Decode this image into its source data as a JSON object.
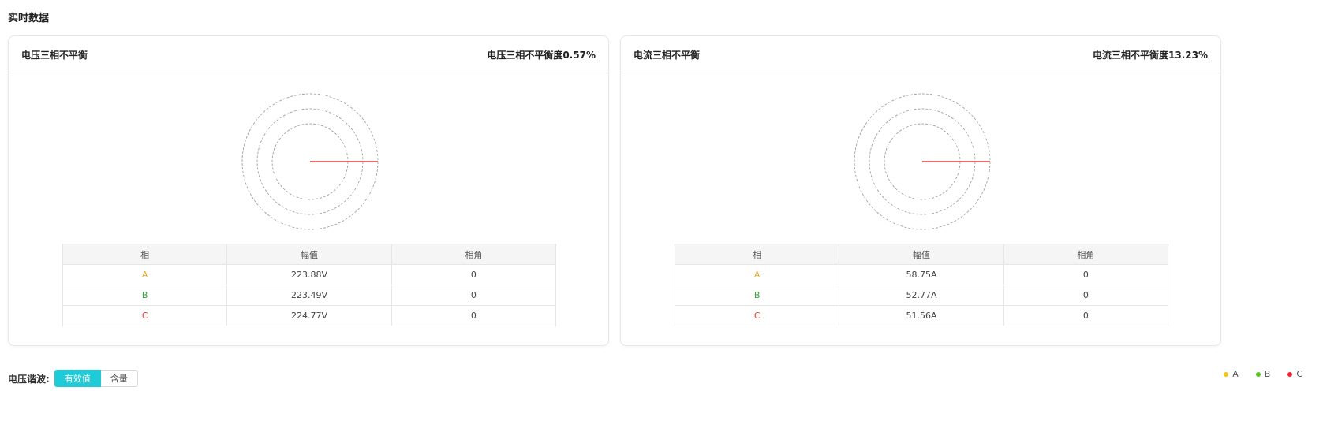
{
  "page": {
    "title": "实时数据"
  },
  "voltage_card": {
    "title": "电压三相不平衡",
    "imbalance": "电压三相不平衡度0.57%",
    "table": {
      "headers": [
        "相",
        "幅值",
        "相角"
      ],
      "rows": [
        {
          "phase": "A",
          "amplitude": "223.88V",
          "angle": "0"
        },
        {
          "phase": "B",
          "amplitude": "223.49V",
          "angle": "0"
        },
        {
          "phase": "C",
          "amplitude": "224.77V",
          "angle": "0"
        }
      ]
    }
  },
  "current_card": {
    "title": "电流三相不平衡",
    "imbalance": "电流三相不平衡度13.23%",
    "table": {
      "headers": [
        "相",
        "幅值",
        "相角"
      ],
      "rows": [
        {
          "phase": "A",
          "amplitude": "58.75A",
          "angle": "0"
        },
        {
          "phase": "B",
          "amplitude": "52.77A",
          "angle": "0"
        },
        {
          "phase": "C",
          "amplitude": "51.56A",
          "angle": "0"
        }
      ]
    }
  },
  "harmonic": {
    "label": "电压谐波:",
    "options": [
      "有效值",
      "含量"
    ],
    "selected": "有效值"
  },
  "legend": [
    {
      "label": "A",
      "color": "#f5c518"
    },
    {
      "label": "B",
      "color": "#52c41a"
    },
    {
      "label": "C",
      "color": "#f5222d"
    }
  ],
  "colors": {
    "accent": "#1ecbd6",
    "phasor_line": "#e83a3a"
  }
}
